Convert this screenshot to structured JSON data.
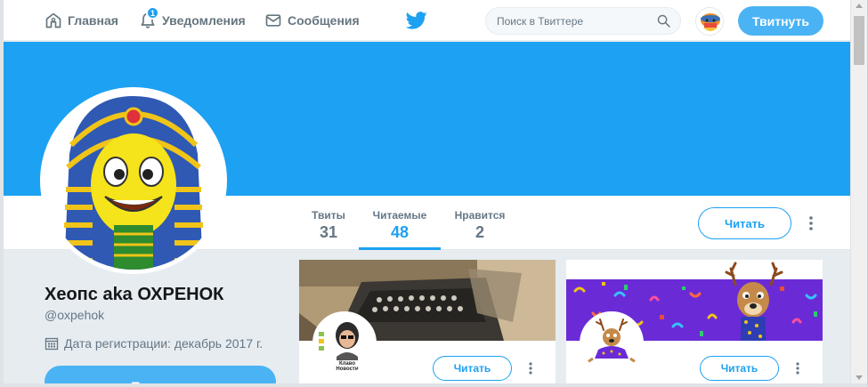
{
  "nav": {
    "home_label": "Главная",
    "notifications_label": "Уведомления",
    "notifications_count": "1",
    "messages_label": "Сообщения",
    "search_placeholder": "Поиск в Твиттере",
    "tweet_button": "Твитнуть"
  },
  "colors": {
    "accent": "#1da1f2",
    "banner": "#1da1f2",
    "tweet_button": "#4ab3f4",
    "muted_text": "#657786"
  },
  "profile_nav": {
    "stats": [
      {
        "label": "Твиты",
        "value": "31"
      },
      {
        "label": "Читаемые",
        "value": "48"
      },
      {
        "label": "Нравится",
        "value": "2"
      }
    ],
    "active_stat": "Читаемые",
    "follow_button": "Читать"
  },
  "profile": {
    "name": "Хеопс aka ОХРЕНОК",
    "handle": "@oxpehok",
    "joined": "Дата регистрации: декабрь 2017 г.",
    "tweet_button": "Твитнуть"
  },
  "following_cards": [
    {
      "follow_button": "Читать",
      "avatar_text_line1": "Клаво",
      "avatar_text_line2": "Новости"
    },
    {
      "follow_button": "Читать"
    }
  ],
  "icons": [
    "home-icon",
    "bell-icon",
    "envelope-icon",
    "twitter-bird-icon",
    "search-icon",
    "calendar-icon",
    "more-vertical-icon"
  ]
}
